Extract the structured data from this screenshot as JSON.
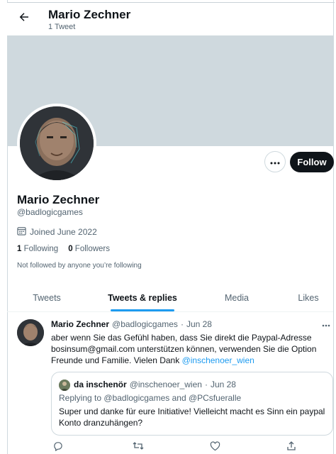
{
  "header": {
    "name": "Mario Zechner",
    "tweet_count": "1 Tweet",
    "back_icon": "arrow-left-icon"
  },
  "profile": {
    "name": "Mario Zechner",
    "handle": "@badlogicgames",
    "joined": "Joined June 2022",
    "following_count": "1",
    "following_label": "Following",
    "followers_count": "0",
    "followers_label": "Followers",
    "not_followed": "Not followed by anyone you’re following",
    "follow_button": "Follow",
    "banner_color": "#cfd9de"
  },
  "tabs": [
    {
      "label": "Tweets",
      "active": false
    },
    {
      "label": "Tweets & replies",
      "active": true
    },
    {
      "label": "Media",
      "active": false
    },
    {
      "label": "Likes",
      "active": false
    }
  ],
  "tweet": {
    "author": "Mario Zechner",
    "handle": "@badlogicgames",
    "separator": "·",
    "date": "Jun 28",
    "text_lines": [
      "aber wenn Sie das Gefühl haben, dass Sie direkt die Paypal-Adresse",
      "bosinsum@gmail.com unterstützen können, verwenden Sie die Option",
      "Freunde und Familie. Vielen Dank"
    ],
    "mention": "@inschenoer_wien",
    "quote": {
      "author": "da inschenör",
      "handle": "@inschenoer_wien",
      "separator": "·",
      "date": "Jun 28",
      "reply_to": "Replying to @badlogicgames and @PCsfueralle",
      "text_lines": [
        "Super und danke für eure Initiative! Vielleicht macht es Sinn ein paypal",
        "Konto dranzuhängen?"
      ]
    }
  },
  "colors": {
    "accent": "#1d9bf0",
    "text": "#0f1419",
    "muted": "#536471",
    "follow_button_bg": "#0f1419"
  }
}
